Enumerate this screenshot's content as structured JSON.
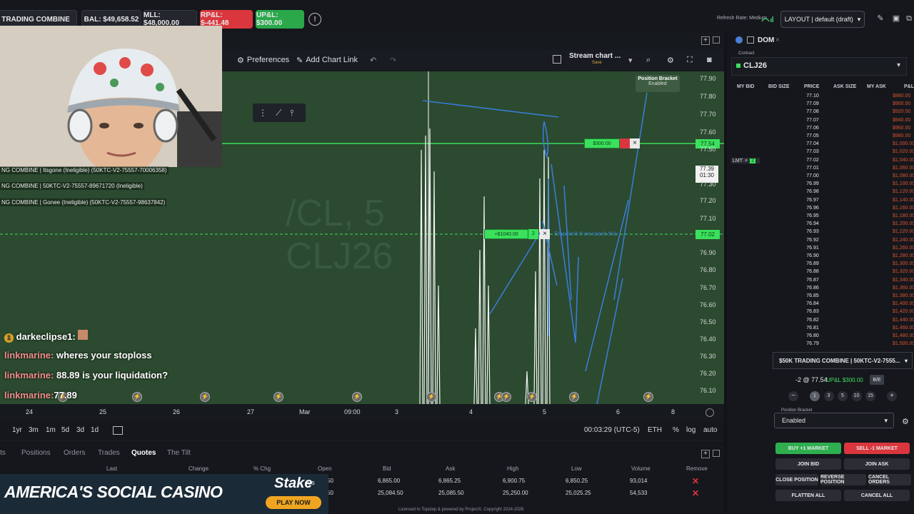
{
  "topbar": {
    "combine_label": "TRADING COMBINE",
    "bal": "BAL: $49,658.52",
    "mll": "MLL: $48,000.00",
    "rpnl": "RP&L: $-441.48",
    "upnl": "UP&L: $300.00",
    "refresh": "Refresh Rate: Medium",
    "layout": "LAYOUT | default (draft)"
  },
  "chart_toolbar": {
    "preferences": "Preferences",
    "add_chart_link": "Add Chart Link",
    "stream_chart": "Stream chart ...",
    "save": "Save"
  },
  "position_bracket_badge": {
    "title": "Position Bracket",
    "status": "Enabled"
  },
  "chart": {
    "watermark_symbol": "/CL, 5",
    "watermark_contract": "CLJ26",
    "green_order_label": "$300.00",
    "limit_order_label": "+$1040.00",
    "limit_order_qty": "2",
    "limit_order_note": "Stop limit if we reach this",
    "price_tag_green": "77.54",
    "price_tag_limit": "77.02",
    "price_tag_current": "77.39",
    "countdown": "01:30"
  },
  "chart_data": {
    "type": "line",
    "price_axis": [
      "77.90",
      "77.80",
      "77.70",
      "77.60",
      "77.50",
      "77.39",
      "77.30",
      "77.20",
      "77.10",
      "77.02",
      "76.90",
      "76.80",
      "76.70",
      "76.60",
      "76.50",
      "76.40",
      "76.30",
      "76.20",
      "76.10"
    ],
    "time_axis": [
      "24",
      "25",
      "26",
      "27",
      "Mar",
      "09:00",
      "3",
      "4",
      "5",
      "6",
      "8"
    ]
  },
  "timebar": {
    "frames": [
      "1yr",
      "3m",
      "1m",
      "5d",
      "3d",
      "1d"
    ],
    "clock": "00:03:29 (UTC-5)",
    "session": "ETH",
    "pct": "%",
    "log": "log",
    "auto": "auto"
  },
  "quotes": {
    "tabs": [
      "ts",
      "Positions",
      "Orders",
      "Trades",
      "Quotes",
      "The Tilt"
    ],
    "headers": [
      "Last",
      "Change",
      "% Chg",
      "Open",
      "Bid",
      "Ask",
      "High",
      "Low",
      "Volume",
      "Remove"
    ],
    "rows": [
      {
        "open": "50",
        "bid": "6,865.00",
        "ask": "6,865.25",
        "high": "6,900.75",
        "low": "6,850.25",
        "volume": "93,014"
      },
      {
        "open": "50",
        "bid": "25,084.50",
        "ask": "25,085.50",
        "high": "25,250.00",
        "low": "25,025.25",
        "volume": "54,533"
      }
    ]
  },
  "footer": "Licensed to Topstep & powered by ProjectX. Copyright 2024-2026",
  "ad": {
    "headline": "AMERICA'S SOCIAL CASINO",
    "brand": "Stake",
    "brand_sub": "US",
    "cta": "PLAY NOW"
  },
  "accounts": [
    "NG COMBINE | Itsgone (Ineligible) (50KTC-V2-75557-70006358)",
    "NG COMBINE | 50KTC-V2-75557-89671720 (Ineligible)",
    "NG COMBINE | Gonee (Ineligible) (50KTC-V2-75557-98637842)"
  ],
  "chat": [
    {
      "user": "darkeclipse1:",
      "text": ""
    },
    {
      "user": "linkmarine:",
      "text": "wheres your stoploss"
    },
    {
      "user": "linkmarine:",
      "text": "88.89 is your liquidation?"
    },
    {
      "user": "linkmarine:",
      "text": "77.89"
    }
  ],
  "dom": {
    "title": "DOM",
    "contract_label": "Contract",
    "contract": "CLJ26",
    "headers": [
      "MY BID",
      "BID SIZE",
      "PRICE",
      "ASK SIZE",
      "MY ASK",
      "P&L"
    ],
    "rows": [
      {
        "price": "77.10",
        "pl": "$880.00"
      },
      {
        "price": "77.09",
        "pl": "$900.00"
      },
      {
        "price": "77.08",
        "pl": "$920.00"
      },
      {
        "price": "77.07",
        "pl": "$940.00"
      },
      {
        "price": "77.06",
        "pl": "$960.00"
      },
      {
        "price": "77.05",
        "pl": "$980.00"
      },
      {
        "price": "77.04",
        "pl": "$1,000.00"
      },
      {
        "price": "77.03",
        "pl": "$1,020.00"
      },
      {
        "price": "77.02",
        "pl": "$1,040.00"
      },
      {
        "price": "77.01",
        "pl": "$1,060.00"
      },
      {
        "price": "77.00",
        "pl": "$1,080.00"
      },
      {
        "price": "76.99",
        "pl": "$1,100.00"
      },
      {
        "price": "76.98",
        "pl": "$1,120.00"
      },
      {
        "price": "76.97",
        "pl": "$1,140.00"
      },
      {
        "price": "76.96",
        "pl": "$1,160.00"
      },
      {
        "price": "76.95",
        "pl": "$1,180.00"
      },
      {
        "price": "76.94",
        "pl": "$1,200.00"
      },
      {
        "price": "76.93",
        "pl": "$1,220.00"
      },
      {
        "price": "76.92",
        "pl": "$1,240.00"
      },
      {
        "price": "76.91",
        "pl": "$1,260.00"
      },
      {
        "price": "76.90",
        "pl": "$1,280.00"
      },
      {
        "price": "76.89",
        "pl": "$1,300.00"
      },
      {
        "price": "76.88",
        "pl": "$1,320.00"
      },
      {
        "price": "76.87",
        "pl": "$1,340.00"
      },
      {
        "price": "76.86",
        "pl": "$1,360.00"
      },
      {
        "price": "76.85",
        "pl": "$1,380.00"
      },
      {
        "price": "76.84",
        "pl": "$1,400.00"
      },
      {
        "price": "76.83",
        "pl": "$1,420.00"
      },
      {
        "price": "76.82",
        "pl": "$1,440.00"
      },
      {
        "price": "76.81",
        "pl": "$1,460.00"
      },
      {
        "price": "76.80",
        "pl": "$1,480.00"
      },
      {
        "price": "76.79",
        "pl": "$1,500.00"
      }
    ],
    "lmt_label": "LMT",
    "lmt_qty": "2",
    "account": "$50K TRADING COMBINE | 50KTC-V2-7555...",
    "position": "-2 @ 77.54",
    "upl": "UP&L $300.00",
    "be": "B/E",
    "qty_options": [
      "1",
      "3",
      "5",
      "10",
      "15"
    ],
    "bracket_label": "Position Bracket",
    "bracket_value": "Enabled",
    "buy": "BUY +1 MARKET",
    "sell": "SELL -1 MARKET",
    "join_bid": "JOIN BID",
    "join_ask": "JOIN ASK",
    "close_position": "CLOSE POSITION",
    "reverse_position": "REVERSE POSITION",
    "cancel_orders": "CANCEL ORDERS",
    "flatten_all": "FLATTEN ALL",
    "cancel_all": "CANCEL ALL"
  }
}
